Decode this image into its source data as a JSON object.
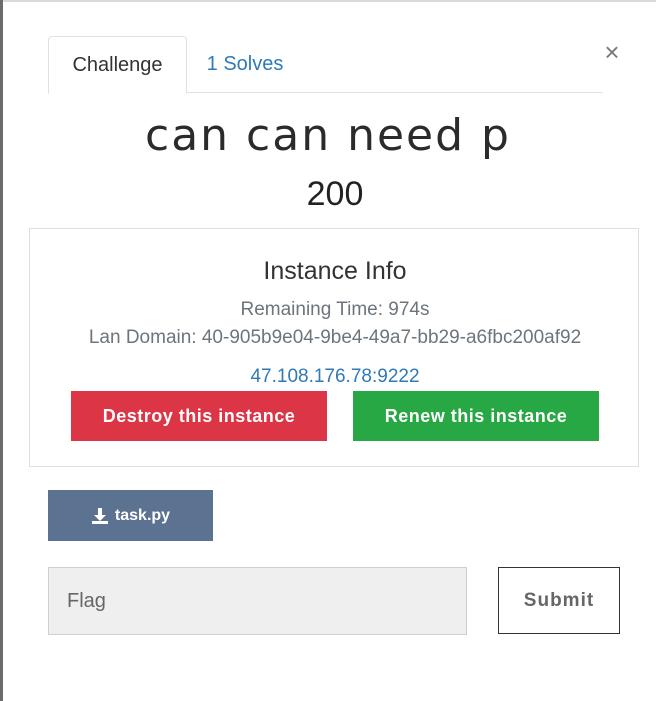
{
  "modal": {
    "close_glyph": "×",
    "tabs": [
      {
        "label": "Challenge",
        "active": true
      },
      {
        "label": "1 Solves",
        "active": false
      }
    ],
    "challenge_name": "can can need p",
    "points": "200"
  },
  "instance": {
    "title": "Instance Info",
    "remaining_time": "Remaining Time: 974s",
    "lan_domain": "Lan Domain: 40-905b9e04-9be4-49a7-bb29-a6fbc200af92",
    "address": "47.108.176.78:9222",
    "destroy_label": "Destroy this instance",
    "renew_label": "Renew this instance"
  },
  "files": [
    {
      "name": "task.py",
      "icon": "download-icon"
    }
  ],
  "submission": {
    "placeholder": "Flag",
    "value": "",
    "submit_label": "Submit"
  },
  "colors": {
    "link": "#2f7ab7",
    "danger": "#dc3545",
    "success": "#28a745",
    "file_button": "#5b7290"
  }
}
